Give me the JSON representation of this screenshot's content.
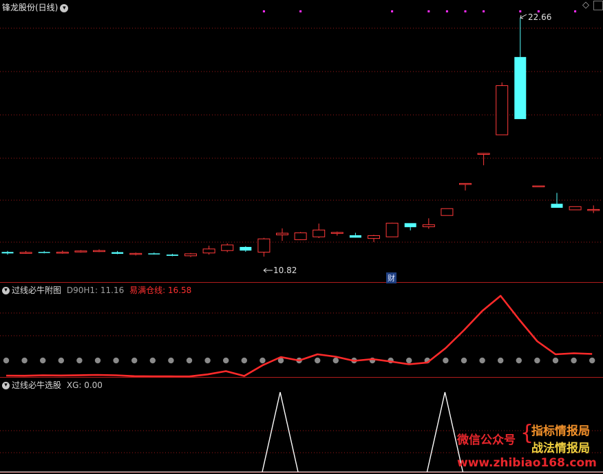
{
  "header": {
    "stock_title": "锋龙股份(日线)",
    "main_menu_icon": "chevron-down-icon",
    "corner_icon": "diamond-icon"
  },
  "main_pane": {
    "high_label": "22.66",
    "low_label": "10.82",
    "news_badge": "财",
    "candles": [
      {
        "o": 11.05,
        "h": 11.1,
        "l": 10.92,
        "c": 10.98
      },
      {
        "o": 11.02,
        "h": 11.1,
        "l": 10.96,
        "c": 11.03
      },
      {
        "o": 11.05,
        "h": 11.1,
        "l": 10.98,
        "c": 11.0
      },
      {
        "o": 11.0,
        "h": 11.12,
        "l": 10.96,
        "c": 11.04
      },
      {
        "o": 11.08,
        "h": 11.14,
        "l": 11.02,
        "c": 11.1
      },
      {
        "o": 11.1,
        "h": 11.18,
        "l": 11.04,
        "c": 11.12
      },
      {
        "o": 11.04,
        "h": 11.1,
        "l": 10.94,
        "c": 10.96
      },
      {
        "o": 10.98,
        "h": 11.02,
        "l": 10.88,
        "c": 10.98
      },
      {
        "o": 10.98,
        "h": 11.02,
        "l": 10.92,
        "c": 10.94
      },
      {
        "o": 10.92,
        "h": 10.96,
        "l": 10.84,
        "c": 10.86
      },
      {
        "o": 10.86,
        "h": 11.0,
        "l": 10.8,
        "c": 10.96
      },
      {
        "o": 11.0,
        "h": 11.36,
        "l": 10.92,
        "c": 11.2
      },
      {
        "o": 11.12,
        "h": 11.48,
        "l": 11.04,
        "c": 11.4
      },
      {
        "o": 11.3,
        "h": 11.34,
        "l": 11.06,
        "c": 11.12
      },
      {
        "o": 11.04,
        "h": 11.75,
        "l": 10.82,
        "c": 11.7
      },
      {
        "o": 11.9,
        "h": 12.22,
        "l": 11.6,
        "c": 11.98
      },
      {
        "o": 11.66,
        "h": 12.04,
        "l": 11.64,
        "c": 12.0
      },
      {
        "o": 11.8,
        "h": 12.46,
        "l": 11.74,
        "c": 12.14
      },
      {
        "o": 11.98,
        "h": 12.06,
        "l": 11.86,
        "c": 12.02
      },
      {
        "o": 11.88,
        "h": 12.0,
        "l": 11.78,
        "c": 11.76
      },
      {
        "o": 11.72,
        "h": 11.9,
        "l": 11.54,
        "c": 11.86
      },
      {
        "o": 11.8,
        "h": 12.5,
        "l": 11.8,
        "c": 12.48
      },
      {
        "o": 12.48,
        "h": 12.48,
        "l": 12.12,
        "c": 12.28
      },
      {
        "o": 12.3,
        "h": 12.72,
        "l": 12.2,
        "c": 12.4
      },
      {
        "o": 12.86,
        "h": 13.2,
        "l": 12.86,
        "c": 13.2
      },
      {
        "o": 14.45,
        "h": 14.45,
        "l": 14.1,
        "c": 14.45
      },
      {
        "o": 15.9,
        "h": 15.96,
        "l": 15.35,
        "c": 15.94
      },
      {
        "o": 16.86,
        "h": 19.46,
        "l": 16.86,
        "c": 19.3
      },
      {
        "o": 20.72,
        "h": 22.66,
        "l": 17.64,
        "c": 17.64
      },
      {
        "o": 14.33,
        "h": 14.33,
        "l": 14.33,
        "c": 14.33
      },
      {
        "o": 13.44,
        "h": 13.98,
        "l": 13.24,
        "c": 13.24
      },
      {
        "o": 13.14,
        "h": 13.3,
        "l": 13.14,
        "c": 13.3
      },
      {
        "o": 13.16,
        "h": 13.36,
        "l": 12.98,
        "c": 13.16
      }
    ],
    "signal_dots": [
      14,
      16,
      21,
      23,
      24,
      25,
      26,
      28,
      29,
      31
    ]
  },
  "indicator_pane": {
    "title": "过线必牛附图",
    "line1_label": "D90H1: 11.16",
    "line2_label": "易满仓线: 16.58",
    "line1_color": "#c0c0c0",
    "line2_color": "#ff2a2a",
    "red_line": [
      2,
      1.8,
      2.4,
      2.2,
      2.6,
      3,
      2.5,
      1.2,
      1,
      0.9,
      0.8,
      3.8,
      8.5,
      1.5,
      17,
      29,
      24,
      33,
      29.5,
      23.5,
      26,
      22.5,
      18.5,
      21,
      42,
      68,
      96,
      118,
      84,
      52,
      33,
      34.5,
      33.5
    ]
  },
  "xg_pane": {
    "title": "过线必牛选股",
    "value_label": "XG: 0.00",
    "signal_bars": [
      15,
      24
    ]
  },
  "watermark": {
    "left": "微信公众号",
    "brace": "{",
    "line1": "指标情报局",
    "line2": "战法情报局",
    "url": "www.zhibiao168.com"
  }
}
